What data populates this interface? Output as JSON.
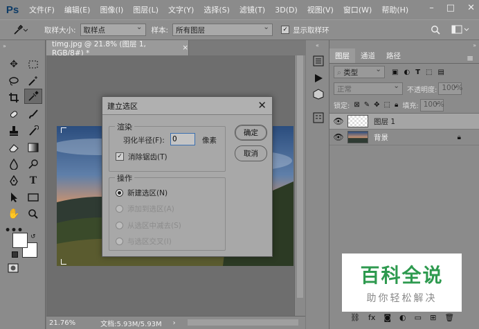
{
  "app": {
    "logo": "Ps"
  },
  "menu": [
    "文件(F)",
    "编辑(E)",
    "图像(I)",
    "图层(L)",
    "文字(Y)",
    "选择(S)",
    "滤镜(T)",
    "3D(D)",
    "视图(V)",
    "窗口(W)",
    "帮助(H)"
  ],
  "window_controls": {
    "minimize": "–",
    "restore": "□",
    "close": "✕"
  },
  "options": {
    "sample_size_label": "取样大小:",
    "sample_size_value": "取样点",
    "sample_label": "样本:",
    "sample_value": "所有图层",
    "show_ring_label": "显示取样环"
  },
  "document": {
    "tab_title": "timg.jpg @ 21.8% (图层 1, RGB/8#) *",
    "tab_close": "×",
    "zoom": "21.76%",
    "doc_info": "文档:5.93M/5.93M",
    "status_arrow": "›"
  },
  "layers_panel": {
    "tabs": [
      "图层",
      "通道",
      "路径"
    ],
    "filter_label": "类型",
    "blend_mode": "正常",
    "opacity_label": "不透明度:",
    "opacity_value": "100%",
    "lock_label": "锁定:",
    "fill_label": "填充:",
    "fill_value": "100%",
    "layers": [
      {
        "name": "图层 1"
      },
      {
        "name": "背景"
      }
    ]
  },
  "dialog": {
    "title": "建立选区",
    "close": "✕",
    "render_group": "渲染",
    "feather_label": "羽化半径(F):",
    "feather_value": "0",
    "feather_unit": "像素",
    "antialias_label": "消除锯齿(T)",
    "operation_group": "操作",
    "options": [
      "新建选区(N)",
      "添加到选区(A)",
      "从选区中减去(S)",
      "与选区交叉(I)"
    ],
    "ok": "确定",
    "cancel": "取消"
  },
  "watermark": {
    "title": "百科全说",
    "subtitle": "助你轻松解决"
  },
  "colors": {
    "accent_green": "#2e9a4f",
    "ps_blue": "#0d3b66"
  }
}
